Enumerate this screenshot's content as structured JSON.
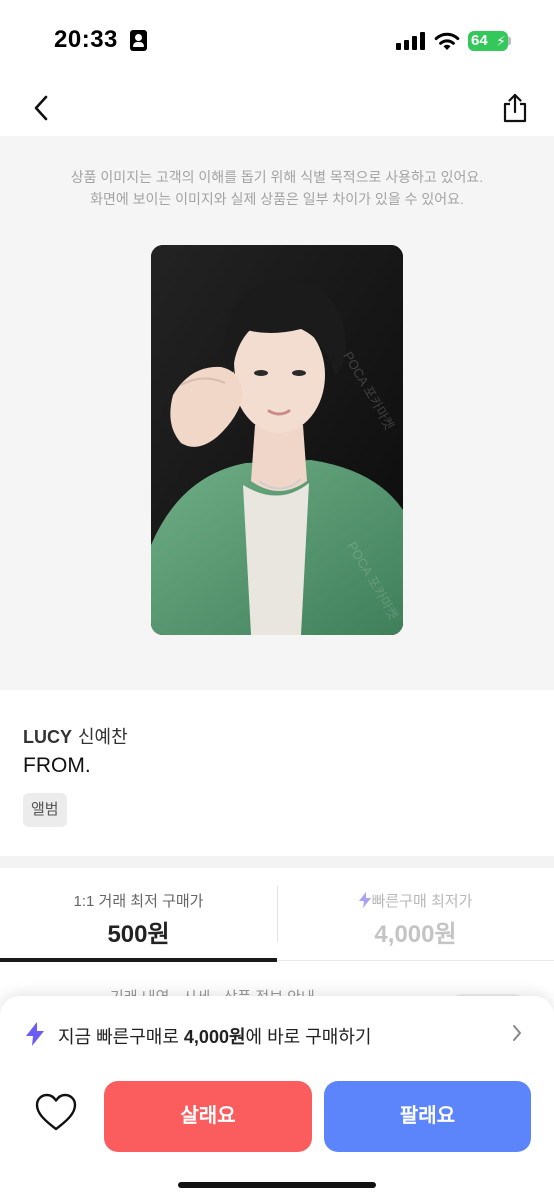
{
  "status_bar": {
    "time": "20:33",
    "battery": "64",
    "icons": [
      "person-badge-icon",
      "cellular-signal-icon",
      "wifi-icon",
      "battery-charging-icon"
    ]
  },
  "header": {
    "back_icon": "chevron-left-icon",
    "share_icon": "share-icon"
  },
  "image_section": {
    "disclaimer_line1": "상품 이미지는 고객의 이해를 돕기 위해 식별 목적으로 사용하고 있어요.",
    "disclaimer_line2": "화면에 보이는 이미지와 실제 상품은 일부 차이가 있을 수 있어요.",
    "watermark": "POCA 포카마켓"
  },
  "product": {
    "brand": "LUCY",
    "member": "신예찬",
    "name": "FROM.",
    "tag": "앨범"
  },
  "price_tabs": [
    {
      "label": "1:1 거래 최저 구매가",
      "value": "500원",
      "active": true
    },
    {
      "label": "빠른구매 최저가",
      "value": "4,000원",
      "active": false,
      "icon": "lightning-icon"
    }
  ],
  "peek": {
    "text": "기래 내역 · 시세 · 상품 정보 안내"
  },
  "bottom_sheet": {
    "quick_buy_prefix": "지금 빠른구매로 ",
    "quick_buy_price": "4,000원",
    "quick_buy_suffix": "에 바로 구매하기",
    "buy_label": "살래요",
    "sell_label": "팔래요"
  },
  "colors": {
    "buy": "#fb5d5f",
    "sell": "#5c85fc",
    "accent_purple": "#6b5cf6",
    "battery_green": "#34c759"
  }
}
